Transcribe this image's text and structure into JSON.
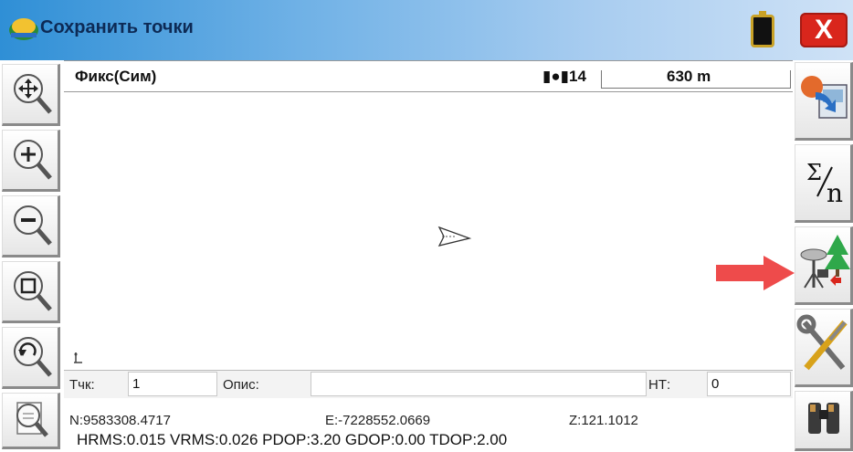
{
  "window": {
    "title": "Сохранить точки",
    "close_label": "X",
    "accent_color": "#d9261c"
  },
  "left_toolbar": {
    "items": [
      {
        "name": "pan-icon"
      },
      {
        "name": "zoom-in-icon"
      },
      {
        "name": "zoom-out-icon"
      },
      {
        "name": "zoom-extents-icon"
      },
      {
        "name": "zoom-previous-icon"
      },
      {
        "name": "zoom-list-icon"
      }
    ]
  },
  "right_toolbar": {
    "items": [
      {
        "name": "export-icon"
      },
      {
        "name": "sigma-n-icon"
      },
      {
        "name": "gnss-antenna-tree-icon"
      },
      {
        "name": "tools-settings-icon"
      },
      {
        "name": "binoculars-icon"
      }
    ]
  },
  "status": {
    "fix_status": "Фикс(Сим)",
    "satellites": "14",
    "scale": "630 m"
  },
  "entry": {
    "point_label": "Тчк:",
    "point_value": "1",
    "description_label": "Опис:",
    "description_value": "",
    "height_label": "НТ:",
    "height_value": "0"
  },
  "coordinates": {
    "north": "N:9583308.4717",
    "east": "E:-7228552.0669",
    "elevation": "Z:121.1012",
    "precision": "HRMS:0.015 VRMS:0.026 PDOP:3.20 GDOP:0.00 TDOP:2.00"
  }
}
